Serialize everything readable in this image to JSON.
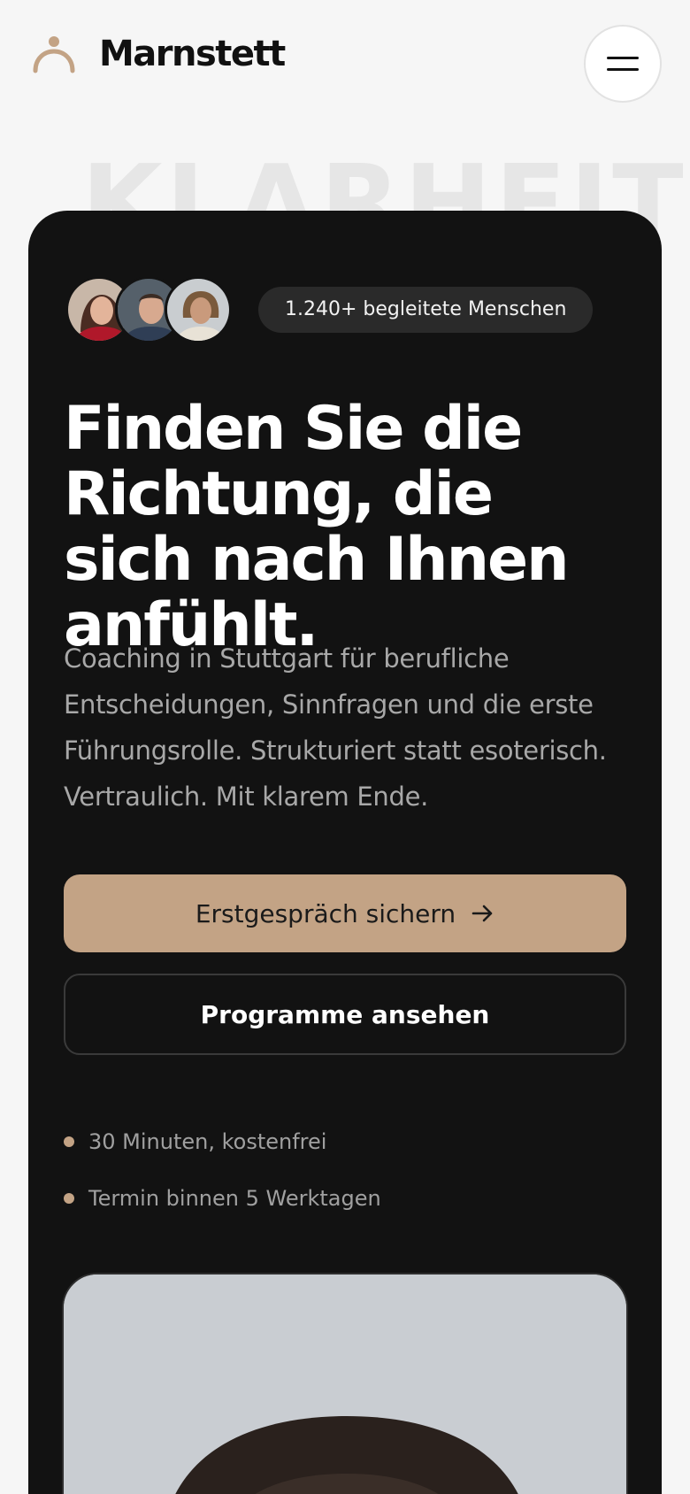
{
  "brand": {
    "name": "Marnstett",
    "accent": "#c3a385"
  },
  "header": {
    "menu_icon": "hamburger-icon"
  },
  "hero": {
    "watermark": "KLARHEIT",
    "badge": "1.240+ begleitete Menschen",
    "headline": "Finden Sie die Richtung, die sich nach Ihnen anfühlt.",
    "lede": "Coaching in Stuttgart für berufliche Entscheidungen, Sinnfragen und die erste Führungsrolle. Strukturiert statt esoterisch. Vertraulich. Mit klarem Ende.",
    "cta_primary": "Erstgespräch sichern",
    "cta_primary_icon": "arrow-right-icon",
    "cta_secondary": "Programme ansehen",
    "bullets": [
      "30 Minuten, kostenfrei",
      "Termin binnen 5 Werktagen"
    ]
  },
  "colors": {
    "page_bg": "#f6f6f6",
    "card_bg": "#121212"
  }
}
